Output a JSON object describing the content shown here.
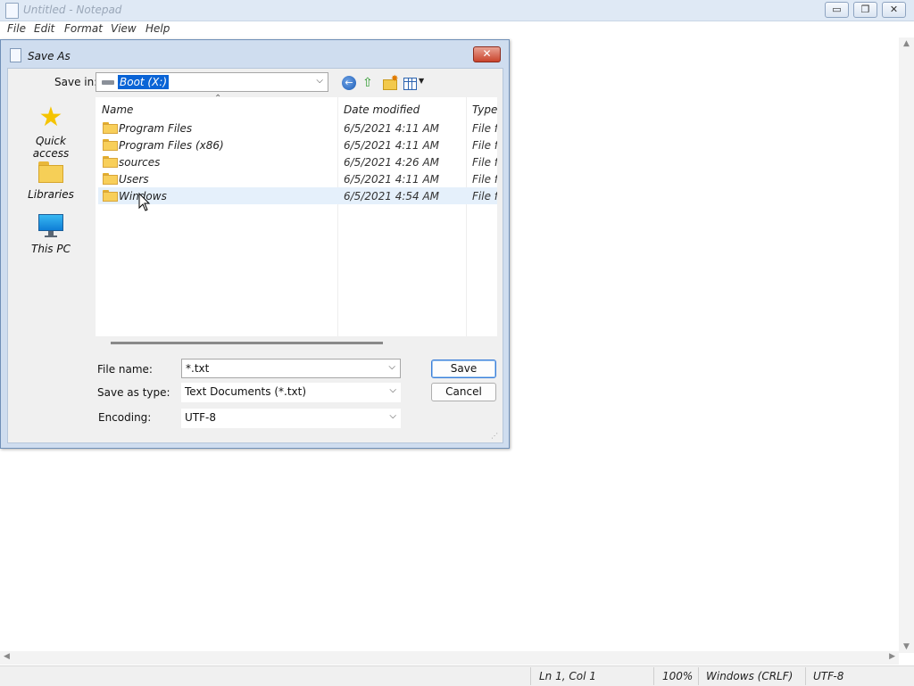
{
  "notepad": {
    "title": "Untitled - Notepad",
    "window_buttons": {
      "minimize": "▭",
      "restore": "❐",
      "close": "✕"
    },
    "menu": [
      "File",
      "Edit",
      "Format",
      "View",
      "Help"
    ],
    "status": {
      "position": "Ln 1, Col 1",
      "zoom": "100%",
      "line_ending": "Windows (CRLF)",
      "encoding": "UTF-8"
    }
  },
  "dialog": {
    "title": "Save As",
    "close_glyph": "✕",
    "save_in": {
      "label": "Save in:",
      "value": "Boot (X:)"
    },
    "toolbar_icons": [
      "back-icon",
      "up-folder-icon",
      "new-folder-icon",
      "views-menu-icon"
    ],
    "places": [
      {
        "label": "Quick access",
        "icon": "star-icon"
      },
      {
        "label": "Libraries",
        "icon": "folder-icon"
      },
      {
        "label": "This PC",
        "icon": "monitor-icon"
      }
    ],
    "columns": {
      "name": "Name",
      "date": "Date modified",
      "type": "Type"
    },
    "files": [
      {
        "name": "Program Files",
        "date": "6/5/2021 4:11 AM",
        "type": "File fo"
      },
      {
        "name": "Program Files (x86)",
        "date": "6/5/2021 4:11 AM",
        "type": "File fo"
      },
      {
        "name": "sources",
        "date": "6/5/2021 4:26 AM",
        "type": "File fo"
      },
      {
        "name": "Users",
        "date": "6/5/2021 4:11 AM",
        "type": "File fo"
      },
      {
        "name": "Windows",
        "date": "6/5/2021 4:54 AM",
        "type": "File fo"
      }
    ],
    "hovered_row": "Windows",
    "filename": {
      "label": "File name:",
      "value": "*.txt"
    },
    "save_type": {
      "label": "Save as type:",
      "value": "Text Documents (*.txt)"
    },
    "encoding": {
      "label": "Encoding:",
      "value": "UTF-8"
    },
    "buttons": {
      "save": "Save",
      "cancel": "Cancel"
    }
  },
  "colors": {
    "selection": "#0a64d6",
    "hover_row": "#e5f0fb",
    "dialog_frame": "#cfddef",
    "close_red": "#c9442c"
  }
}
